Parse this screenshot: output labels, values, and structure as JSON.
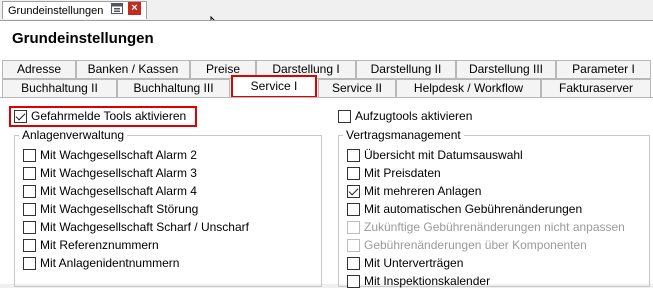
{
  "doc_tab": {
    "label": "Grundeinstellungen",
    "close_glyph": "×"
  },
  "icons": {
    "pin": "pin-icon",
    "close": "close-icon",
    "cursor": "mouse-cursor-icon"
  },
  "page_title": "Grundeinstellungen",
  "tabs_row1": [
    "Adresse",
    "Banken / Kassen",
    "Preise",
    "Darstellung I",
    "Darstellung II",
    "Darstellung III",
    "Parameter I"
  ],
  "tabs_row2": [
    "Buchhaltung II",
    "Buchhaltung III",
    "Service I",
    "Service II",
    "Helpdesk / Workflow",
    "Fakturaserver"
  ],
  "active_tab": "Service I",
  "left": {
    "main_checkbox": {
      "label": "Gefahrmelde Tools aktivieren",
      "checked": true
    },
    "group": {
      "legend": "Anlagenverwaltung",
      "items": [
        {
          "label": "Mit Wachgesellschaft Alarm 2",
          "checked": false
        },
        {
          "label": "Mit Wachgesellschaft Alarm 3",
          "checked": false
        },
        {
          "label": "Mit Wachgesellschaft Alarm 4",
          "checked": false
        },
        {
          "label": "Mit Wachgesellschaft Störung",
          "checked": false
        },
        {
          "label": "Mit Wachgesellschaft Scharf / Unscharf",
          "checked": false
        },
        {
          "label": "Mit Referenznummern",
          "checked": false
        },
        {
          "label": "Mit Anlagenidentnummern",
          "checked": false
        }
      ]
    }
  },
  "right": {
    "main_checkbox": {
      "label": "Aufzugtools aktivieren",
      "checked": false
    },
    "group": {
      "legend": "Vertragsmanagement",
      "items": [
        {
          "label": "Übersicht mit Datumsauswahl",
          "checked": false,
          "disabled": false
        },
        {
          "label": "Mit Preisdaten",
          "checked": false,
          "disabled": false
        },
        {
          "label": "Mit mehreren Anlagen",
          "checked": true,
          "disabled": false
        },
        {
          "label": "Mit automatischen Gebührenänderungen",
          "checked": false,
          "disabled": false
        },
        {
          "label": "Zukünftige Gebührenänderungen nicht anpassen",
          "checked": false,
          "disabled": true
        },
        {
          "label": "Gebührenänderungen über Komponenten",
          "checked": false,
          "disabled": true
        },
        {
          "label": "Mit Unterverträgen",
          "checked": false,
          "disabled": false
        },
        {
          "label": "Mit Inspektionskalender",
          "checked": false,
          "disabled": false
        }
      ]
    }
  },
  "colors": {
    "highlight": "#e00000",
    "close_button": "#c42b1c"
  }
}
